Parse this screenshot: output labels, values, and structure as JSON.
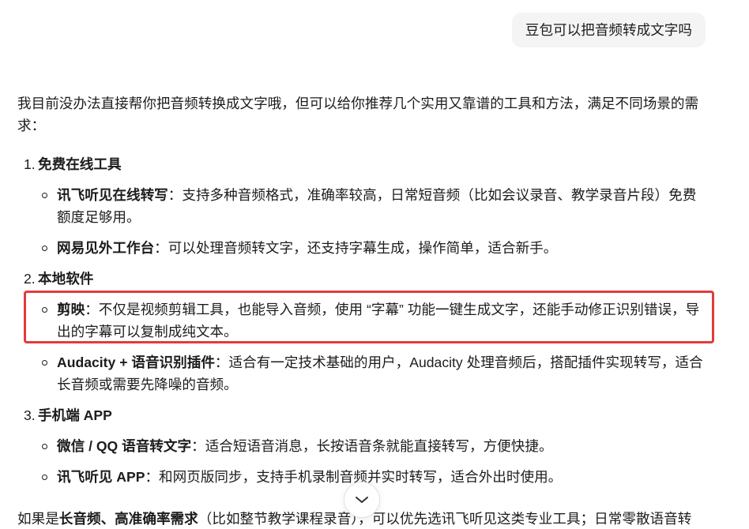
{
  "user_message": "豆包可以把音频转成文字吗",
  "assistant": {
    "intro": "我目前没办法直接帮你把音频转换成文字哦，但可以给你推荐几个实用又靠谱的工具和方法，满足不同场景的需求：",
    "sections": [
      {
        "number": "1.",
        "title": "免费在线工具",
        "items": [
          {
            "term": "讯飞听见在线转写",
            "desc": "：支持多种音频格式，准确率较高，日常短音频（比如会议录音、教学录音片段）免费额度足够用。"
          },
          {
            "term": "网易见外工作台",
            "desc": "：可以处理音频转文字，还支持字幕生成，操作简单，适合新手。"
          }
        ]
      },
      {
        "number": "2.",
        "title": "本地软件",
        "items": [
          {
            "term": "剪映",
            "desc": "：不仅是视频剪辑工具，也能导入音频，使用 “字幕” 功能一键生成文字，还能手动修正识别错误，导出的字幕可以复制成纯文本。",
            "highlighted": true
          },
          {
            "term": "Audacity + 语音识别插件",
            "desc": "：适合有一定技术基础的用户，Audacity 处理音频后，搭配插件实现转写，适合长音频或需要先降噪的音频。"
          }
        ]
      },
      {
        "number": "3.",
        "title": "手机端 APP",
        "items": [
          {
            "term": "微信 / QQ 语音转文字",
            "desc": "：适合短语音消息，长按语音条就能直接转写，方便快捷。"
          },
          {
            "term": "讯飞听见 APP",
            "desc": "：和网页版同步，支持手机录制音频并实时转写，适合外出时使用。"
          }
        ]
      }
    ],
    "closing": {
      "prefix": "如果是",
      "emphasis": "长音频、高准确率需求",
      "rest": "（比如整节教学课程录音），可以优先选讯飞听见这类专业工具；日常零散语音转"
    }
  },
  "scroll_down_button": {
    "icon": "chevron-down-icon"
  },
  "theme": {
    "text": "#1c1c1c",
    "bubble": "#f4f4f4",
    "highlight": "#e23b3b",
    "button_border": "#e2e2e2",
    "icon": "#333333"
  }
}
